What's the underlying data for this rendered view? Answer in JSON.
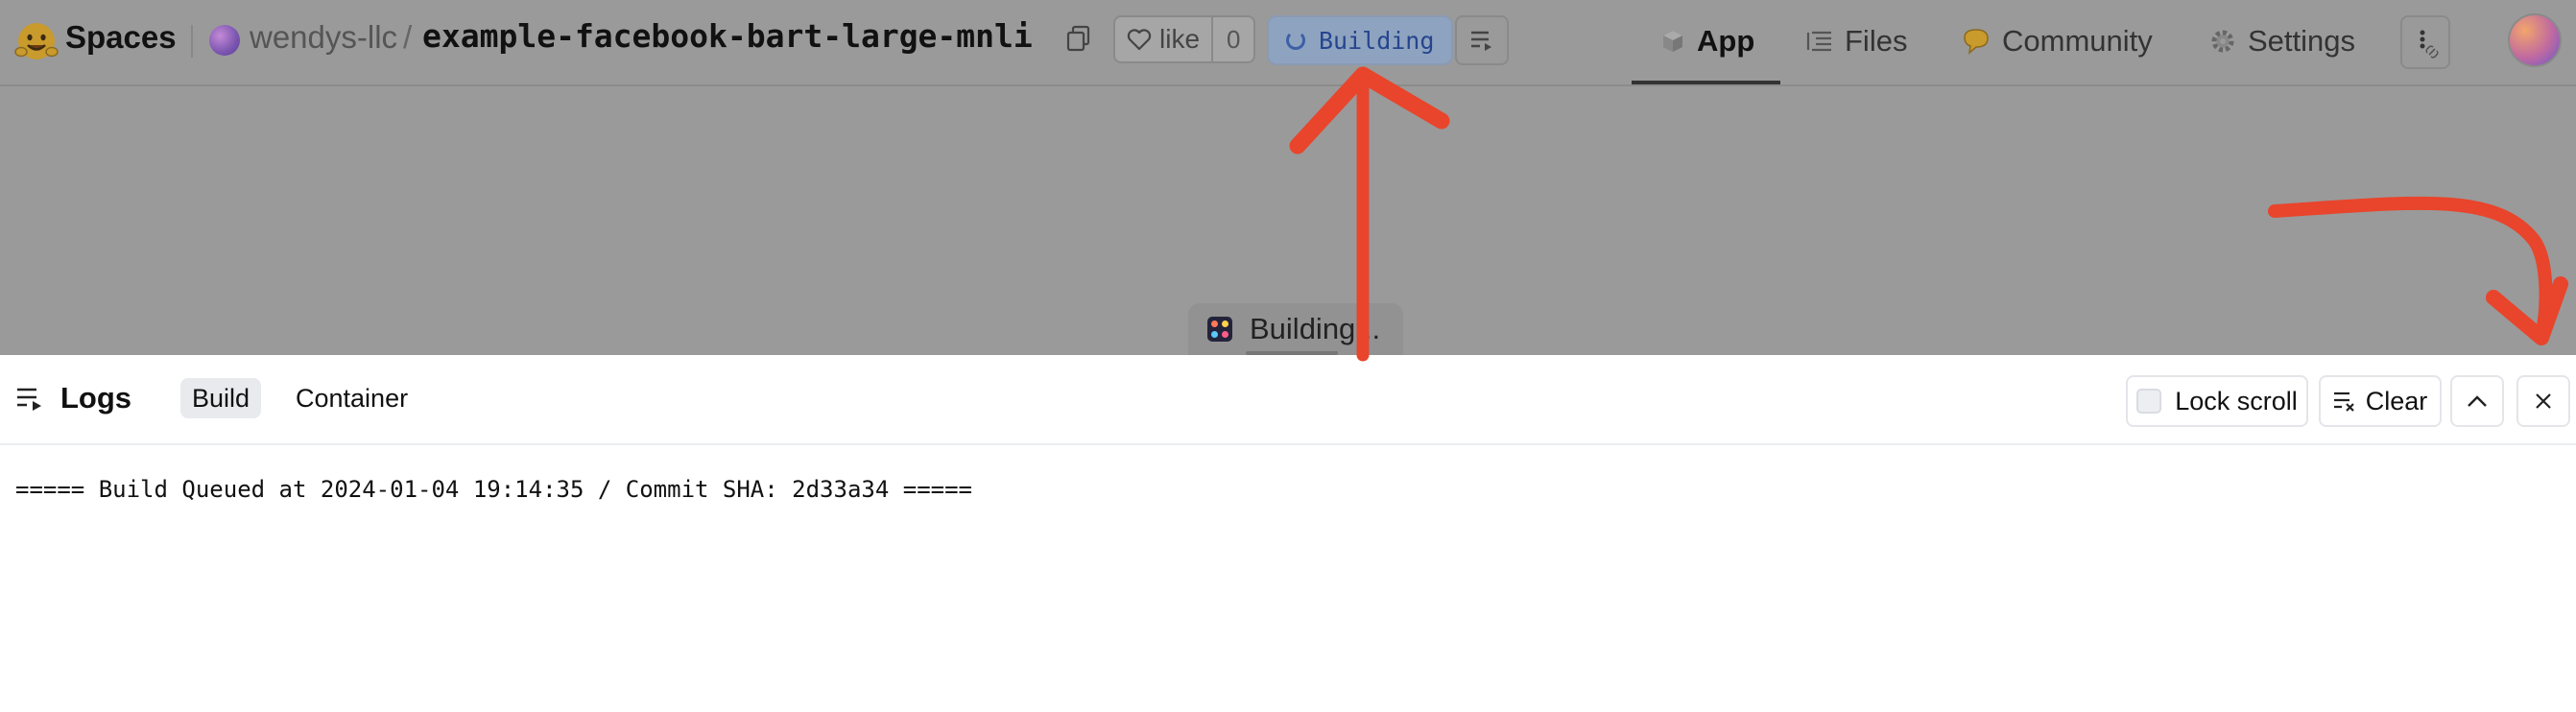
{
  "header": {
    "brand": "Spaces",
    "owner": "wendys-llc",
    "separator": "/",
    "repo": "example-facebook-bart-large-mnli",
    "like_label": "like",
    "like_count": "0",
    "status": "Building",
    "tabs": [
      {
        "label": "App",
        "icon": "cube-icon",
        "active": true
      },
      {
        "label": "Files",
        "icon": "files-icon"
      },
      {
        "label": "Community",
        "icon": "community-icon"
      },
      {
        "label": "Settings",
        "icon": "gear-icon"
      }
    ]
  },
  "main": {
    "building_label": "Building..."
  },
  "logs": {
    "title": "Logs",
    "tabs": [
      {
        "label": "Build",
        "active": true
      },
      {
        "label": "Container",
        "active": false
      }
    ],
    "lock_scroll_label": "Lock scroll",
    "clear_label": "Clear",
    "lines": [
      "===== Build Queued at 2024-01-04 19:14:35 / Commit SHA: 2d33a34 ====="
    ]
  },
  "colors": {
    "overlay": "#9a9a9a",
    "status_text": "#26458f",
    "annotation_arrow": "#e8452c"
  }
}
